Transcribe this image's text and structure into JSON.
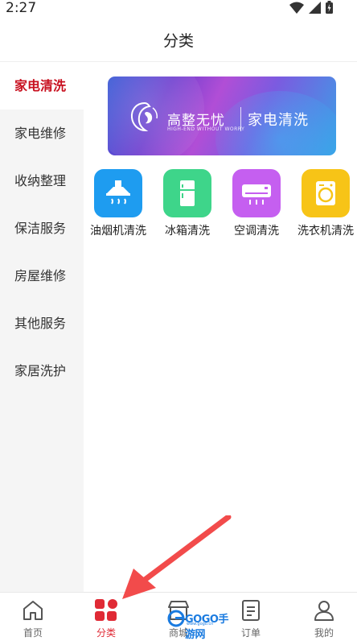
{
  "status_bar": {
    "time": "2:27",
    "icons": [
      "wifi-icon",
      "signal-icon",
      "battery-charging-icon"
    ]
  },
  "header": {
    "title": "分类"
  },
  "sidebar": {
    "items": [
      {
        "label": "家电清洗",
        "active": true
      },
      {
        "label": "家电维修",
        "active": false
      },
      {
        "label": "收纳整理",
        "active": false
      },
      {
        "label": "保洁服务",
        "active": false
      },
      {
        "label": "房屋维修",
        "active": false
      },
      {
        "label": "其他服务",
        "active": false
      },
      {
        "label": "家居洗护",
        "active": false
      }
    ]
  },
  "banner": {
    "brand": "高整无忧",
    "subtitle": "HIGH-END WITHOUT WORRY",
    "service": "家电清洗"
  },
  "categories": [
    {
      "label": "油烟机清洗",
      "icon": "range-hood-icon",
      "color": "#1e9cf0"
    },
    {
      "label": "冰箱清洗",
      "icon": "fridge-icon",
      "color": "#3ed58a"
    },
    {
      "label": "空调清洗",
      "icon": "air-conditioner-icon",
      "color": "#c55ff0"
    },
    {
      "label": "洗衣机清洗",
      "icon": "washing-machine-icon",
      "color": "#f7c417"
    }
  ],
  "bottom_nav": {
    "items": [
      {
        "label": "首页",
        "icon": "home-icon",
        "active": false
      },
      {
        "label": "分类",
        "icon": "category-grid-icon",
        "active": true
      },
      {
        "label": "商城",
        "icon": "shop-icon",
        "active": false
      },
      {
        "label": "订单",
        "icon": "order-icon",
        "active": false
      },
      {
        "label": "我的",
        "icon": "profile-icon",
        "active": false
      }
    ]
  },
  "watermark": {
    "text": "GOGO手游网",
    "url": "www.gogo.cn"
  },
  "colors": {
    "accent": "#c8101f",
    "nav_active": "#e02a35",
    "arrow": "#f24b4b"
  }
}
